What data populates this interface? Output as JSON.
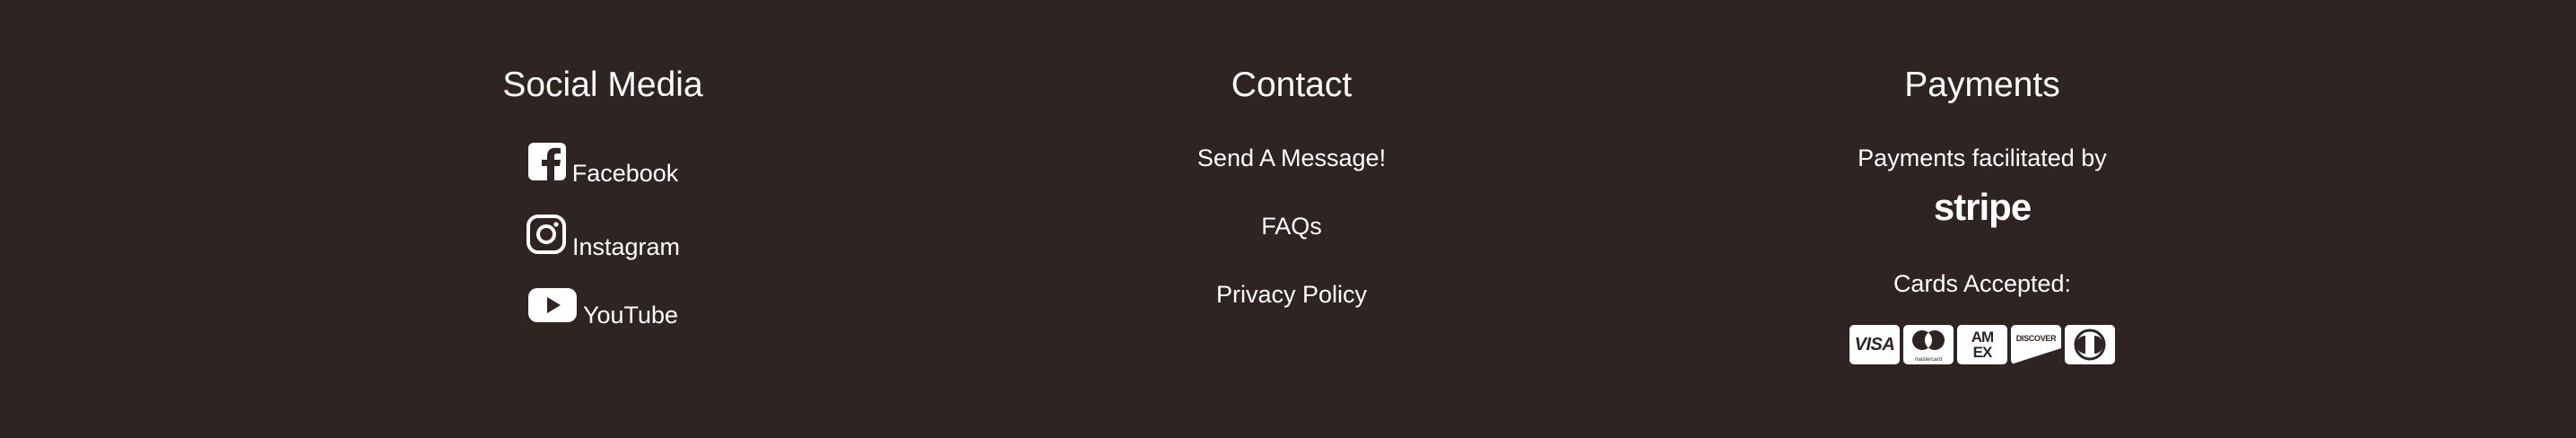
{
  "social": {
    "heading": "Social Media",
    "items": [
      {
        "label": "Facebook",
        "icon": "facebook-icon"
      },
      {
        "label": "Instagram",
        "icon": "instagram-icon"
      },
      {
        "label": "YouTube",
        "icon": "youtube-icon"
      }
    ]
  },
  "contact": {
    "heading": "Contact",
    "links": [
      "Send A Message!",
      "FAQs",
      "Privacy Policy"
    ]
  },
  "payments": {
    "heading": "Payments",
    "facilitated_text": "Payments facilitated by",
    "stripe_logo": "stripe",
    "cards_label": "Cards Accepted:",
    "cards": [
      {
        "name": "visa-card-icon",
        "text": "VISA"
      },
      {
        "name": "mastercard-card-icon",
        "text": "mastercard"
      },
      {
        "name": "amex-card-icon",
        "text": "AM EX"
      },
      {
        "name": "discover-card-icon",
        "text": "DISCOVER"
      },
      {
        "name": "diners-card-icon",
        "text": ""
      }
    ]
  },
  "colors": {
    "background": "#2e2522",
    "text": "#ffffff"
  }
}
